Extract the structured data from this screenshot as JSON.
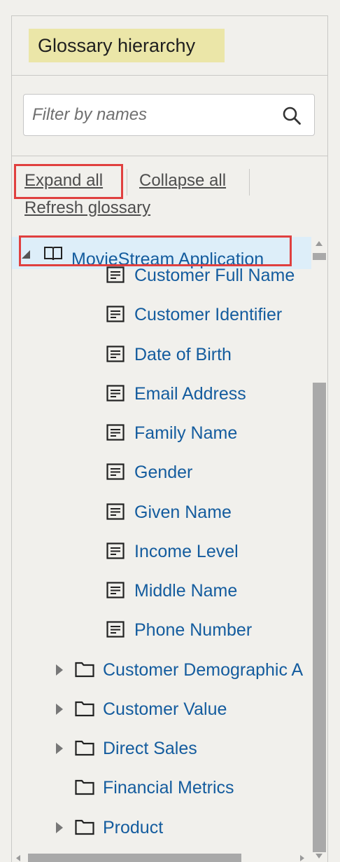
{
  "panel": {
    "title": "Glossary hierarchy",
    "search": {
      "placeholder": "Filter by names",
      "value": "",
      "icon": "search-icon"
    },
    "actions": {
      "expand_all": "Expand all",
      "collapse_all": "Collapse all",
      "refresh": "Refresh glossary"
    }
  },
  "tree": {
    "root": {
      "label": "MovieStream Application",
      "icon": "book-icon",
      "expanded": true
    },
    "terms": [
      "Customer Full Name",
      "Customer Identifier",
      "Date of Birth",
      "Email Address",
      "Family Name",
      "Gender",
      "Given Name",
      "Income Level",
      "Middle Name",
      "Phone Number"
    ],
    "categories": [
      {
        "label": "Customer Demographic A",
        "has_children": true
      },
      {
        "label": "Customer Value",
        "has_children": true
      },
      {
        "label": "Direct Sales",
        "has_children": true
      },
      {
        "label": "Financial Metrics",
        "has_children": false
      },
      {
        "label": "Product",
        "has_children": true
      }
    ]
  },
  "colors": {
    "link": "#145c9e",
    "highlight": "#ebe6a8",
    "selection": "#ddeef9",
    "callout": "#e0403f"
  }
}
